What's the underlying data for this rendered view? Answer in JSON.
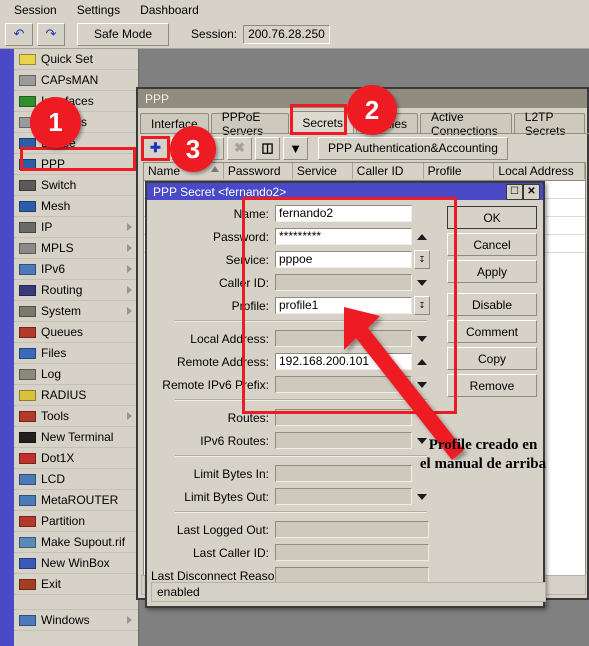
{
  "menubar": {
    "items": [
      {
        "label": "Session"
      },
      {
        "label": "Settings"
      },
      {
        "label": "Dashboard"
      }
    ]
  },
  "toolbar": {
    "undo_icon": "undo-arrow",
    "redo_icon": "redo-arrow",
    "safe_mode_label": "Safe Mode",
    "session_label": "Session:",
    "session_value": "200.76.28.250"
  },
  "sidebar": {
    "items": [
      {
        "label": "Quick Set",
        "icon": "wand-icon",
        "submenu": false
      },
      {
        "label": "CAPsMAN",
        "icon": "antenna-icon",
        "submenu": false
      },
      {
        "label": "Interfaces",
        "icon": "interfaces-icon",
        "submenu": false
      },
      {
        "label": "Wireless",
        "icon": "antenna-icon",
        "submenu": false
      },
      {
        "label": "Bridge",
        "icon": "bridge-icon",
        "submenu": false
      },
      {
        "label": "PPP",
        "icon": "ppp-icon",
        "submenu": false
      },
      {
        "label": "Switch",
        "icon": "switch-icon",
        "submenu": false
      },
      {
        "label": "Mesh",
        "icon": "mesh-icon",
        "submenu": false
      },
      {
        "label": "IP",
        "icon": "ip-icon",
        "submenu": true
      },
      {
        "label": "MPLS",
        "icon": "mpls-icon",
        "submenu": true
      },
      {
        "label": "IPv6",
        "icon": "ipv6-icon",
        "submenu": true
      },
      {
        "label": "Routing",
        "icon": "routing-icon",
        "submenu": true
      },
      {
        "label": "System",
        "icon": "system-icon",
        "submenu": true
      },
      {
        "label": "Queues",
        "icon": "queues-icon",
        "submenu": false
      },
      {
        "label": "Files",
        "icon": "folder-icon",
        "submenu": false
      },
      {
        "label": "Log",
        "icon": "log-icon",
        "submenu": false
      },
      {
        "label": "RADIUS",
        "icon": "radius-icon",
        "submenu": false
      },
      {
        "label": "Tools",
        "icon": "tools-icon",
        "submenu": true
      },
      {
        "label": "New Terminal",
        "icon": "terminal-icon",
        "submenu": false
      },
      {
        "label": "Dot1X",
        "icon": "dot1x-icon",
        "submenu": false
      },
      {
        "label": "LCD",
        "icon": "lcd-icon",
        "submenu": false
      },
      {
        "label": "MetaROUTER",
        "icon": "metarouter-icon",
        "submenu": false
      },
      {
        "label": "Partition",
        "icon": "partition-icon",
        "submenu": false
      },
      {
        "label": "Make Supout.rif",
        "icon": "supout-icon",
        "submenu": false
      },
      {
        "label": "New WinBox",
        "icon": "winbox-icon",
        "submenu": false
      },
      {
        "label": "Exit",
        "icon": "exit-icon",
        "submenu": false
      }
    ],
    "windows_item": {
      "label": "Windows",
      "icon": "window-icon",
      "submenu": true
    }
  },
  "ppp_window": {
    "title": "PPP",
    "tabs": [
      {
        "label": "Interface",
        "active": false
      },
      {
        "label": "PPPoE Servers",
        "active": false
      },
      {
        "label": "Secrets",
        "active": true
      },
      {
        "label": "Profiles",
        "active": false
      },
      {
        "label": "Active Connections",
        "active": false
      },
      {
        "label": "L2TP Secrets",
        "active": false
      }
    ],
    "toolbar": {
      "add_icon": "plus-icon",
      "remove_icon": "minus-icon",
      "enable_icon": "check-icon",
      "disable_icon": "cross-icon",
      "comment_icon": "comment-icon",
      "filter_icon": "filter-icon",
      "auth_button_label": "PPP Authentication&Accounting"
    },
    "table": {
      "columns": [
        "Name",
        "Password",
        "Service",
        "Caller ID",
        "Profile",
        "Local Address"
      ],
      "rows": []
    }
  },
  "dialog": {
    "title": "PPP Secret <fernando2>",
    "maximize_icon": "maximize-icon",
    "close_icon": "close-icon",
    "status": "enabled",
    "fields": [
      {
        "label": "Name:",
        "value": "fernando2",
        "control": "text",
        "filled": true
      },
      {
        "label": "Password:",
        "value": "*********",
        "control": "caret-up",
        "filled": true
      },
      {
        "label": "Service:",
        "value": "pppoe",
        "control": "spinner",
        "filled": true
      },
      {
        "label": "Caller ID:",
        "value": "",
        "control": "caret-down",
        "filled": false
      },
      {
        "label": "Profile:",
        "value": "profile1",
        "control": "spinner",
        "filled": true
      },
      {
        "label": "Local Address:",
        "value": "",
        "control": "caret-down",
        "filled": false
      },
      {
        "label": "Remote Address:",
        "value": "192.168.200.101",
        "control": "caret-up",
        "filled": true
      },
      {
        "label": "Remote IPv6 Prefix:",
        "value": "",
        "control": "caret-down",
        "filled": false
      },
      {
        "label": "Routes:",
        "value": "",
        "control": "caret-down",
        "filled": false
      },
      {
        "label": "IPv6 Routes:",
        "value": "",
        "control": "caret-down",
        "filled": false
      },
      {
        "label": "Limit Bytes In:",
        "value": "",
        "control": "none",
        "filled": false
      },
      {
        "label": "Limit Bytes Out:",
        "value": "",
        "control": "caret-down",
        "filled": false
      },
      {
        "label": "Last Logged Out:",
        "value": "",
        "control": "none",
        "filled": false,
        "wide": true
      },
      {
        "label": "Last Caller ID:",
        "value": "",
        "control": "none",
        "filled": false,
        "wide": true
      },
      {
        "label": "Last Disconnect Reason:",
        "value": "",
        "control": "none",
        "filled": false,
        "wide": true
      }
    ],
    "buttons": [
      {
        "label": "OK"
      },
      {
        "label": "Cancel"
      },
      {
        "label": "Apply"
      },
      {
        "label": "Disable"
      },
      {
        "label": "Comment"
      },
      {
        "label": "Copy"
      },
      {
        "label": "Remove"
      }
    ]
  },
  "annotations": {
    "badges": [
      {
        "number": "1"
      },
      {
        "number": "2"
      },
      {
        "number": "3"
      }
    ],
    "note_line1": "Profile creado en",
    "note_line2": "el manual de arriba",
    "accent_color": "#ee1b22"
  }
}
